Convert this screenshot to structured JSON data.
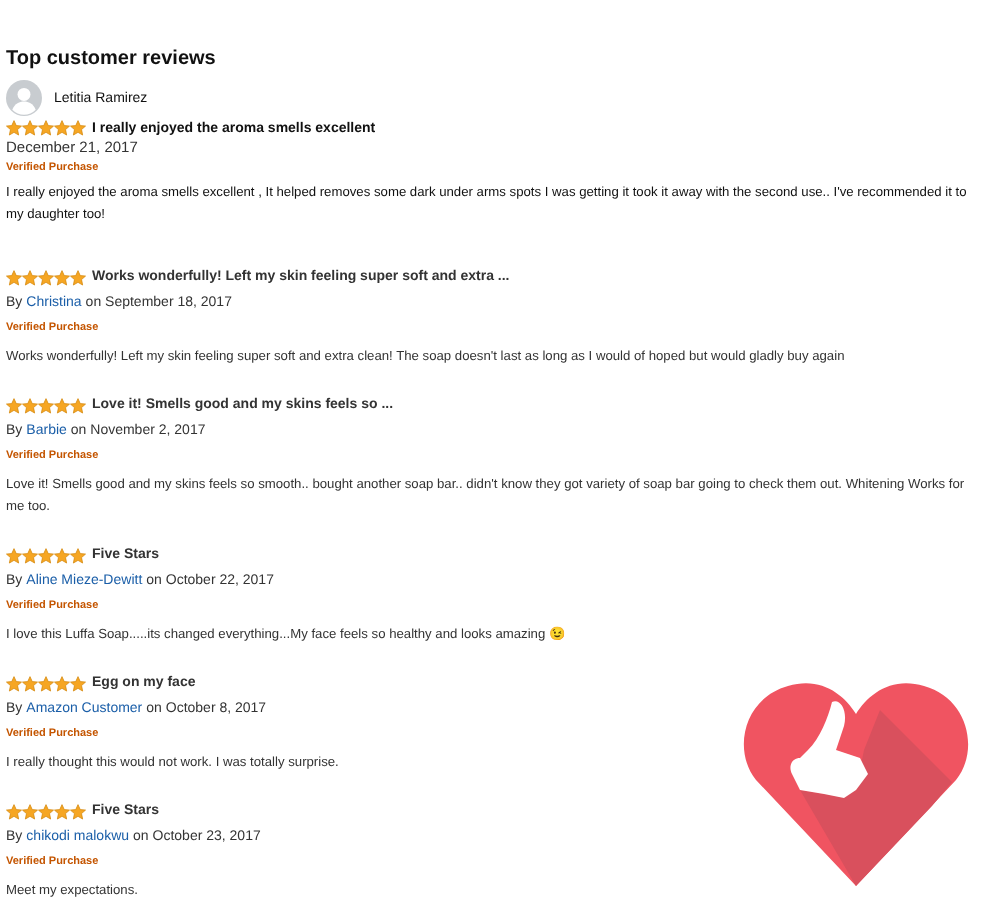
{
  "heading": "Top customer reviews",
  "reviews": [
    {
      "kind": "profile",
      "author": "Letitia Ramirez",
      "stars": 5,
      "title": "I really enjoyed the aroma smells excellent",
      "date": "December 21, 2017",
      "badge": "Verified Purchase",
      "body": "I really enjoyed the aroma smells excellent , It helped removes some dark under arms spots I was getting it took it away with the second use.. I've recommended it to my daughter too!"
    },
    {
      "kind": "byline",
      "stars": 5,
      "title": "Works wonderfully! Left my skin feeling super soft and extra ...",
      "by": "By",
      "author": "Christina",
      "date": "on September 18, 2017",
      "badge": "Verified Purchase",
      "body": "Works wonderfully! Left my skin feeling super soft and extra clean! The soap doesn't last as long as I would of hoped but would gladly buy again"
    },
    {
      "kind": "byline",
      "stars": 5,
      "title": "Love it! Smells good and my skins feels so ...",
      "by": "By",
      "author": "Barbie",
      "date": "on November 2, 2017",
      "badge": "Verified Purchase",
      "body": "Love it! Smells good and my skins feels so smooth.. bought another soap bar.. didn't know they got variety of soap bar going to check them out. Whitening Works for me too."
    },
    {
      "kind": "byline",
      "stars": 5,
      "title": "Five Stars",
      "by": "By",
      "author": "Aline Mieze-Dewitt",
      "date": "on October 22, 2017",
      "badge": "Verified Purchase",
      "body": "I love this Luffa Soap.....its changed everything...My face feels so healthy and looks amazing 😉"
    },
    {
      "kind": "byline",
      "stars": 5,
      "title": "Egg on my face",
      "by": "By",
      "author": "Amazon Customer",
      "date": "on October 8, 2017",
      "badge": "Verified Purchase",
      "body": "I really thought this would not work. I was totally surprise."
    },
    {
      "kind": "byline",
      "stars": 5,
      "title": "Five Stars",
      "by": "By",
      "author": "chikodi malokwu",
      "date": "on October 23, 2017",
      "badge": "Verified Purchase",
      "body": "Meet my expectations."
    }
  ]
}
